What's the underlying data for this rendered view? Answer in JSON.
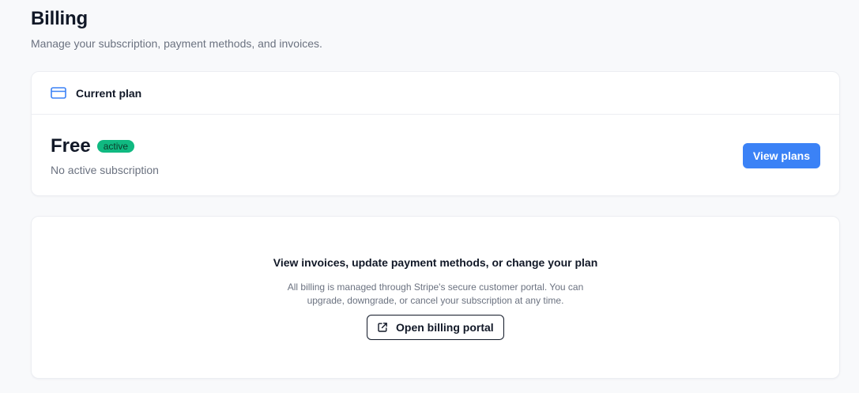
{
  "header": {
    "title": "Billing",
    "subtitle": "Manage your subscription, payment methods, and invoices."
  },
  "current_plan": {
    "section_title": "Current plan",
    "icon": "credit-card-icon",
    "plan_name": "Free",
    "status": "active",
    "description": "No active subscription",
    "view_plans_label": "View plans"
  },
  "portal": {
    "title": "View invoices, update payment methods, or change your plan",
    "description": "All billing is managed through Stripe's secure customer portal. You can upgrade, downgrade, or cancel your subscription at any time.",
    "button_label": "Open billing portal",
    "button_icon": "external-link-icon"
  },
  "colors": {
    "accent": "#3b82f6",
    "status_active": "#10b981",
    "background": "#f8f9fb"
  }
}
